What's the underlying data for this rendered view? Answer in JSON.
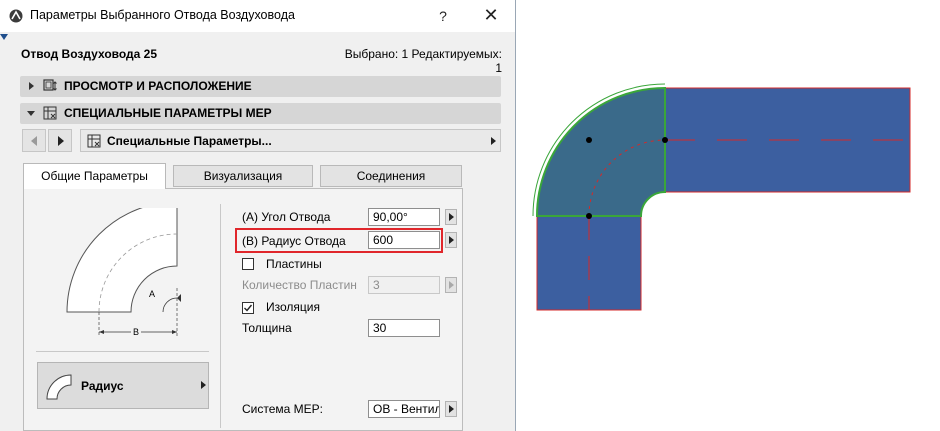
{
  "window": {
    "title": "Параметры Выбранного Отвода Воздуховода",
    "help_icon": "question-mark-icon",
    "close_icon": "close-icon"
  },
  "header": {
    "object_name": "Отвод Воздуховода 25",
    "selected_info": "Выбрано: 1 Редактируемых: 1"
  },
  "panels": [
    {
      "label": "ПРОСМОТР И РАСПОЛОЖЕНИЕ",
      "expanded": false,
      "icon": "floor-plan-icon"
    },
    {
      "label": "СПЕЦИАЛЬНЫЕ ПАРАМЕТРЫ MEP",
      "expanded": true,
      "icon": "mep-settings-icon"
    }
  ],
  "nav": {
    "dropdown_label": "Специальные Параметры..."
  },
  "tabs": [
    {
      "label": "Общие Параметры",
      "active": true
    },
    {
      "label": "Визуализация",
      "active": false
    },
    {
      "label": "Соединения",
      "active": false
    }
  ],
  "preview": {
    "label_a": "A",
    "label_b": "B"
  },
  "params": {
    "angle_label": "(A) Угол Отвода",
    "angle_value": "90,00°",
    "radius_label": "(B) Радиус Отвода",
    "radius_value": "600",
    "plates_label": "Пластины",
    "plates_checked": false,
    "plate_count_label": "Количество Пластин",
    "plate_count_value": "3",
    "insulation_label": "Изоляция",
    "insulation_checked": true,
    "thickness_label": "Толщина",
    "thickness_value": "30",
    "mep_system_label": "Система MEP:",
    "mep_system_value": "ОВ - Вентил"
  },
  "shape_button": {
    "label": "Радиус"
  },
  "colors": {
    "duct_fill": "#3c5fa0",
    "elbow_fill": "#3a6a8a",
    "selection_green": "#3aa63a",
    "outline_red": "#d42a2a",
    "highlight_red": "#e0262b"
  }
}
